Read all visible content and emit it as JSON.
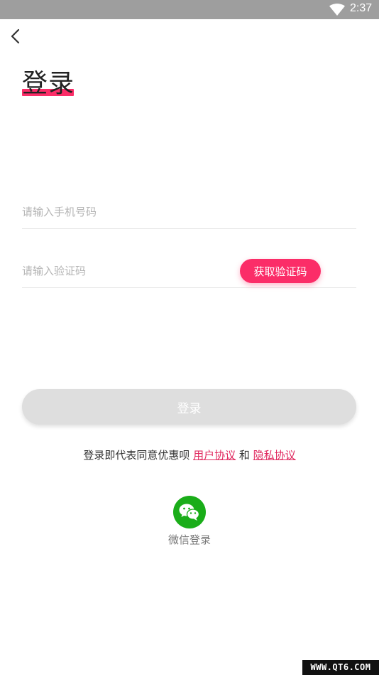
{
  "status_bar": {
    "time": "2:37",
    "wifi_icon": "wifi-icon"
  },
  "header": {
    "back_icon": "chevron-left-icon",
    "title": "登录"
  },
  "form": {
    "phone_placeholder": "请输入手机号码",
    "phone_value": "",
    "code_placeholder": "请输入验证码",
    "code_value": "",
    "get_code_label": "获取验证码"
  },
  "login_button": {
    "label": "登录"
  },
  "agreement": {
    "prefix": "登录即代表同意优惠呗 ",
    "user_agreement": "用户协议",
    "conjunction": " 和 ",
    "privacy_policy": "隐私协议"
  },
  "wechat": {
    "icon": "wechat-icon",
    "label": "微信登录"
  },
  "watermark": {
    "text": "WWW.QT6.COM"
  },
  "colors": {
    "accent": "#fb2d68",
    "status_bar": "#9e9e9e",
    "wechat": "#1aad19",
    "disabled_button": "#dedede"
  }
}
